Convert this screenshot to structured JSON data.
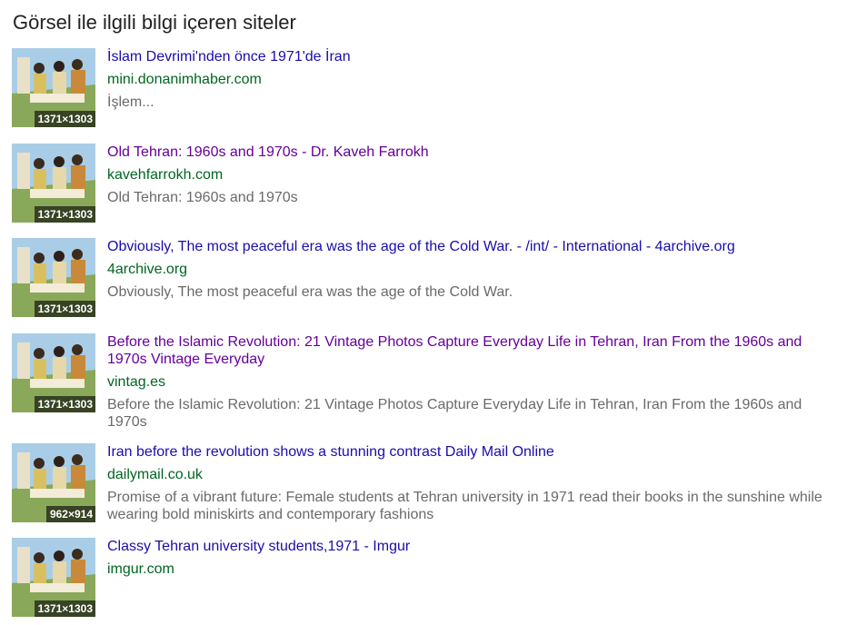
{
  "page": {
    "heading": "Görsel ile ilgili bilgi içeren siteler"
  },
  "results": [
    {
      "title": "İslam Devrimi'nden önce 1971'de İran",
      "site": "mini.donanimhaber.com",
      "snippet": "İşlem...",
      "dims": "1371×1303",
      "visited": false
    },
    {
      "title": "Old Tehran: 1960s and 1970s - Dr. Kaveh Farrokh",
      "site": "kavehfarrokh.com",
      "snippet": "Old Tehran: 1960s and 1970s",
      "dims": "1371×1303",
      "visited": true
    },
    {
      "title": "Obviously, The most peaceful era was the age of the Cold War. - /int/ - International - 4archive.org",
      "site": "4archive.org",
      "snippet": "Obviously, The most peaceful era was the age of the Cold War.",
      "dims": "1371×1303",
      "visited": false
    },
    {
      "title": "Before the Islamic Revolution: 21 Vintage Photos Capture Everyday Life in Tehran, Iran From the 1960s and 1970s Vintage Everyday",
      "site": "vintag.es",
      "snippet": "Before the Islamic Revolution: 21 Vintage Photos Capture Everyday Life in Tehran, Iran From the 1960s and 1970s",
      "dims": "1371×1303",
      "visited": true
    },
    {
      "title": "Iran before the revolution shows a stunning contrast Daily Mail Online",
      "site": "dailymail.co.uk",
      "snippet": "Promise of a vibrant future: Female students at Tehran university in 1971 read their books in the sunshine while wearing bold miniskirts and contemporary fashions",
      "dims": "962×914",
      "visited": false
    },
    {
      "title": "Classy Tehran university students,1971 - Imgur",
      "site": "imgur.com",
      "snippet": "",
      "dims": "1371×1303",
      "visited": false
    }
  ],
  "colors": {
    "link": "#1a0dab",
    "visited": "#660099",
    "site": "#006621",
    "snippet": "#6a6a6a"
  }
}
